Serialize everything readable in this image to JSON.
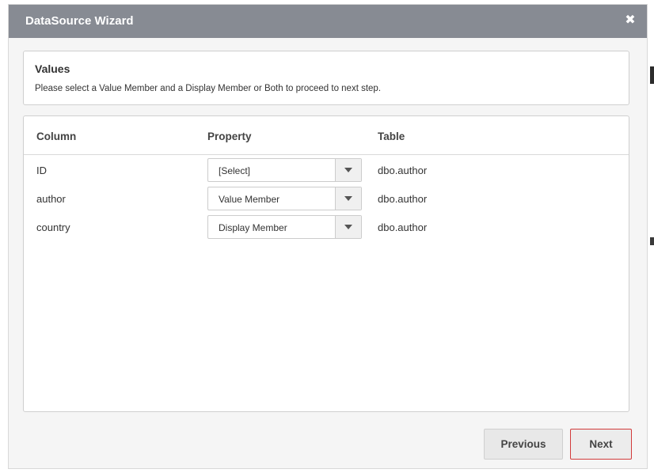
{
  "dialog": {
    "title": "DataSource Wizard",
    "close_icon": "close-icon"
  },
  "values": {
    "heading": "Values",
    "description": "Please select a Value Member and a Display Member or Both to proceed to next step."
  },
  "grid": {
    "headers": {
      "column": "Column",
      "property": "Property",
      "table": "Table"
    },
    "rows": [
      {
        "column": "ID",
        "property": "[Select]",
        "table": "dbo.author"
      },
      {
        "column": "author",
        "property": "Value Member",
        "table": "dbo.author"
      },
      {
        "column": "country",
        "property": "Display Member",
        "table": "dbo.author"
      }
    ]
  },
  "buttons": {
    "previous": "Previous",
    "next": "Next"
  },
  "colors": {
    "titlebar": "#878b93",
    "next_border": "#d23b3b"
  }
}
